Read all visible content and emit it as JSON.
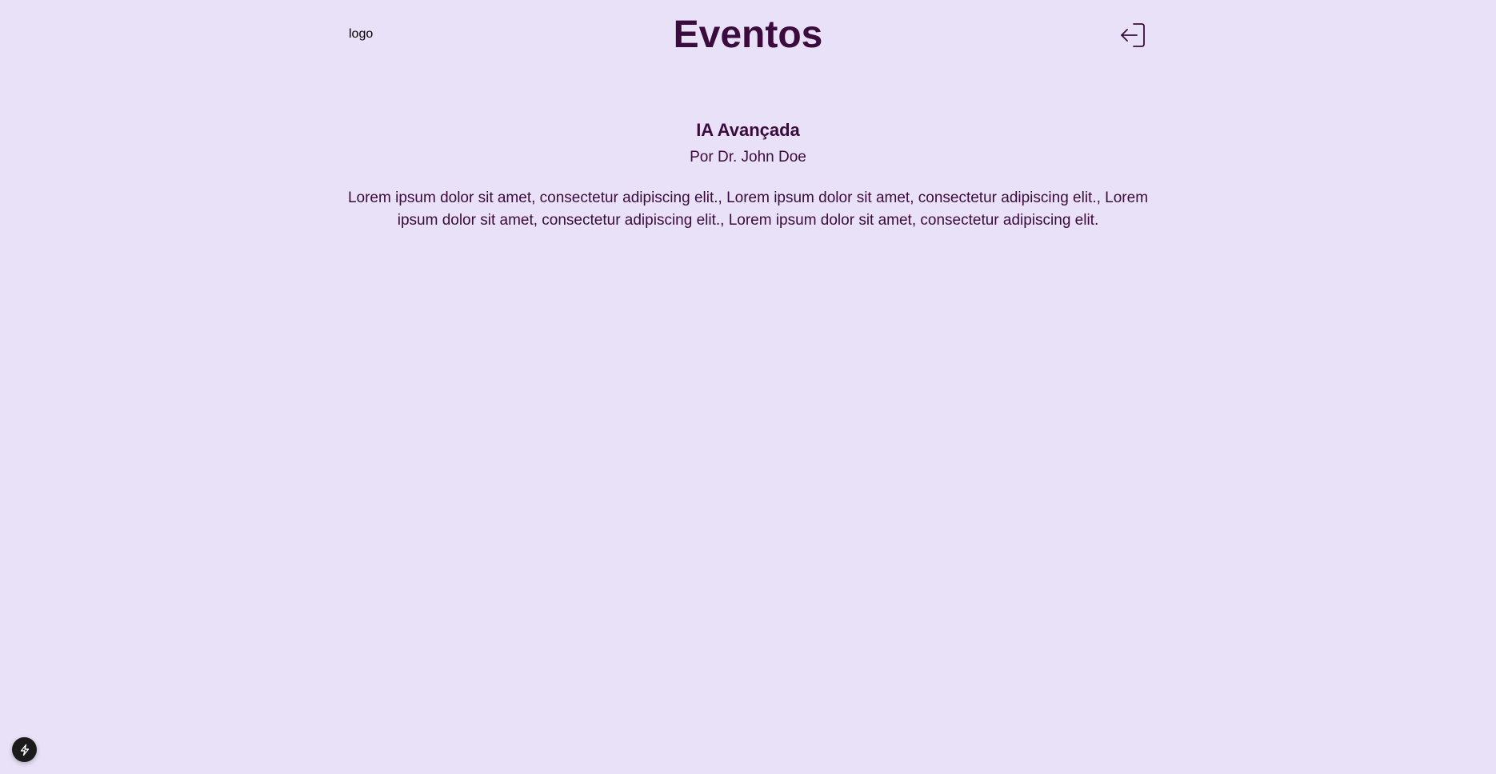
{
  "header": {
    "logo_text": "logo",
    "title": "Eventos",
    "logout_icon": "logout-arrow-icon"
  },
  "event": {
    "title": "IA Avançada",
    "author": "Por Dr. John Doe",
    "description": "Lorem ipsum dolor sit amet, consectetur adipiscing elit., Lorem ipsum dolor sit amet, consectetur adipiscing elit., Lorem ipsum dolor sit amet, consectetur adipiscing elit., Lorem ipsum dolor sit amet, consectetur adipiscing elit."
  },
  "dev_badge": {
    "icon": "lightning-bolt-icon"
  },
  "colors": {
    "background": "#e9e1f7",
    "primary": "#3a0b3c",
    "badge": "#1b1b1b"
  }
}
